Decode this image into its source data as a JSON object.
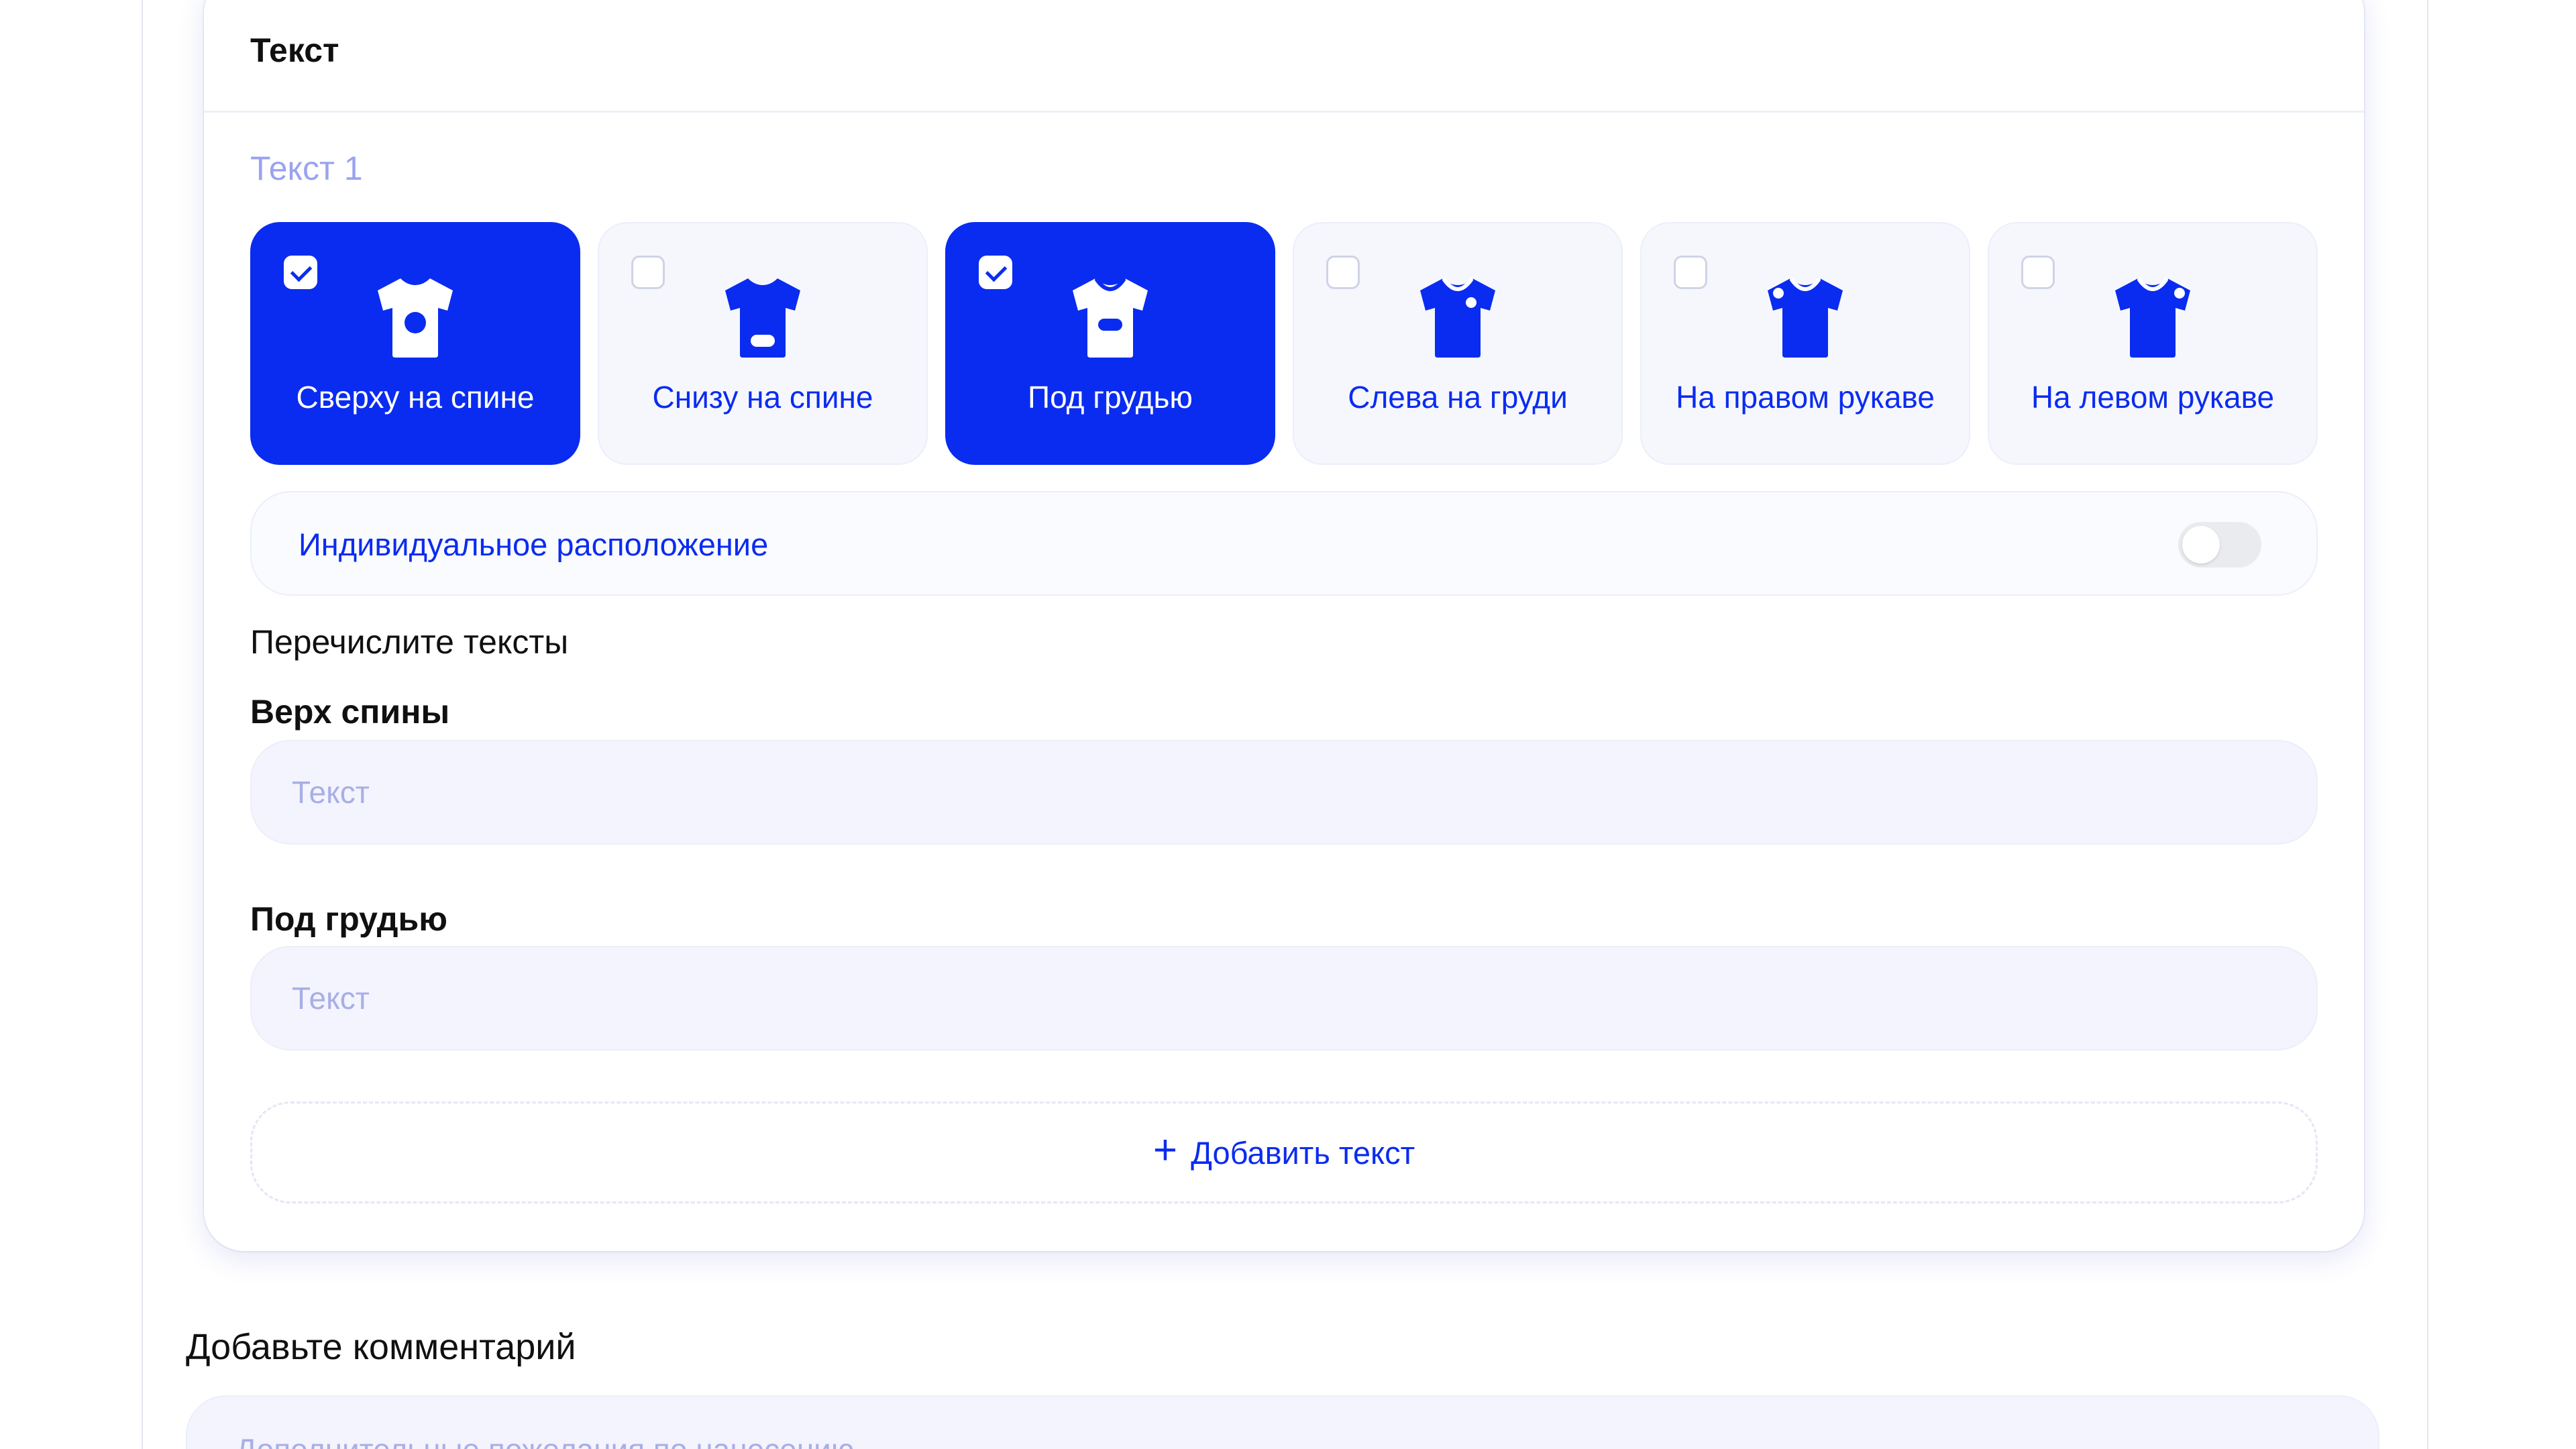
{
  "section": {
    "title": "Текст",
    "subtitle": "Текст 1"
  },
  "placements": [
    {
      "label": "Сверху на спине",
      "selected": true,
      "icon": "tshirt-back-top-icon"
    },
    {
      "label": "Снизу на спине",
      "selected": false,
      "icon": "tshirt-back-bottom-icon"
    },
    {
      "label": "Под грудью",
      "selected": true,
      "icon": "tshirt-under-chest-icon"
    },
    {
      "label": "Слева на груди",
      "selected": false,
      "icon": "tshirt-left-chest-icon"
    },
    {
      "label": "На правом рукаве",
      "selected": false,
      "icon": "tshirt-right-sleeve-icon"
    },
    {
      "label": "На левом рукаве",
      "selected": false,
      "icon": "tshirt-left-sleeve-icon"
    }
  ],
  "custom_placement": {
    "label": "Индивидуальное расположение",
    "enabled": false
  },
  "texts": {
    "heading": "Перечислите тексты",
    "fields": [
      {
        "label": "Верх спины",
        "value": "",
        "placeholder": "Текст"
      },
      {
        "label": "Под грудью",
        "value": "",
        "placeholder": "Текст"
      }
    ],
    "add_label": "Добавить текст"
  },
  "comment": {
    "title": "Добавьте комментарий",
    "value": "",
    "placeholder": "Дополнительные пожелания по нанесению"
  },
  "colors": {
    "accent": "#0a2cf0",
    "tile_bg": "#f6f7fd",
    "field_bg": "#f3f4fd",
    "placeholder": "#a8aee6",
    "subtitle": "#9aa3f0"
  }
}
